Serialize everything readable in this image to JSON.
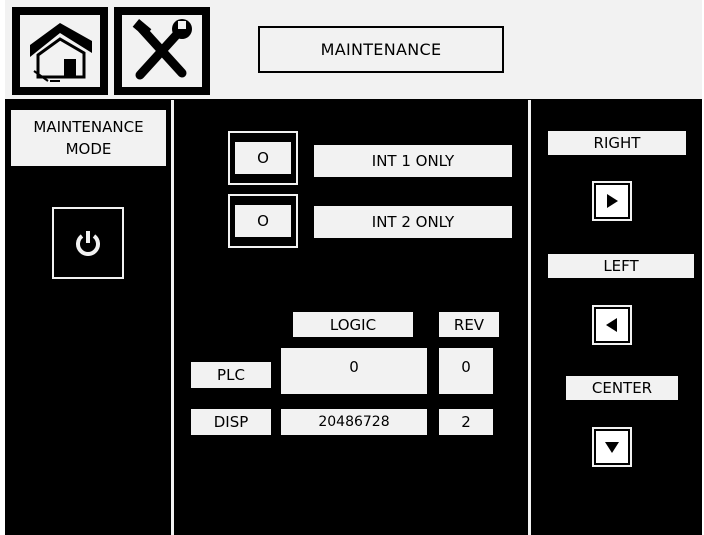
{
  "header": {
    "title": "MAINTENANCE"
  },
  "icons": {
    "home": "home-icon",
    "tools": "tools-icon"
  },
  "left_panel": {
    "mode_label_line1": "MAINTENANCE",
    "mode_label_line2": "MODE",
    "power_icon": "power-icon"
  },
  "center_panel": {
    "int1": {
      "button_label": "O",
      "label": "INT 1 ONLY"
    },
    "int2": {
      "button_label": "O",
      "label": "INT 2 ONLY"
    },
    "table": {
      "headers": {
        "logic": "LOGIC",
        "rev": "REV"
      },
      "rows": [
        {
          "name": "PLC",
          "logic": "0",
          "rev": "0"
        },
        {
          "name": "DISP",
          "logic": "20486728",
          "rev": "2"
        }
      ]
    }
  },
  "right_panel": {
    "right_label": "RIGHT",
    "left_label": "LEFT",
    "center_label": "CENTER",
    "right_icon": "triangle-right-icon",
    "left_icon": "triangle-left-icon",
    "down_icon": "triangle-down-icon"
  },
  "colors": {
    "background": "#000000",
    "panel": "#f2f2f2"
  }
}
